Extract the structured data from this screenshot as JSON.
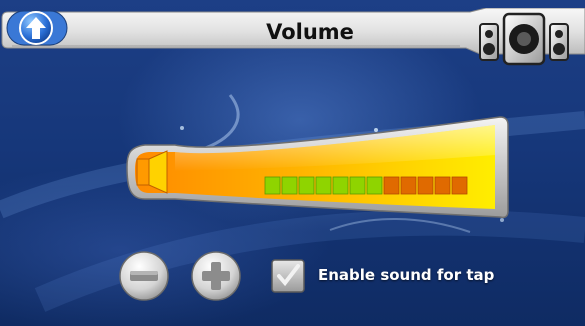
{
  "header": {
    "title": "Volume",
    "back_icon": "arrow-up-icon",
    "speakers_icon": "speakers-icon"
  },
  "volume": {
    "level_segments": 7,
    "total_segments": 12,
    "speaker_icon": "speaker-icon",
    "active_color": "#8fd400",
    "inactive_color": "#e06a00"
  },
  "controls": {
    "minus_icon": "minus-icon",
    "plus_icon": "plus-icon"
  },
  "tap_sound": {
    "label": "Enable sound for tap",
    "checked": true
  },
  "colors": {
    "background": "#16377a",
    "accent_orange": "#ff9a00",
    "accent_yellow": "#ffe600"
  }
}
